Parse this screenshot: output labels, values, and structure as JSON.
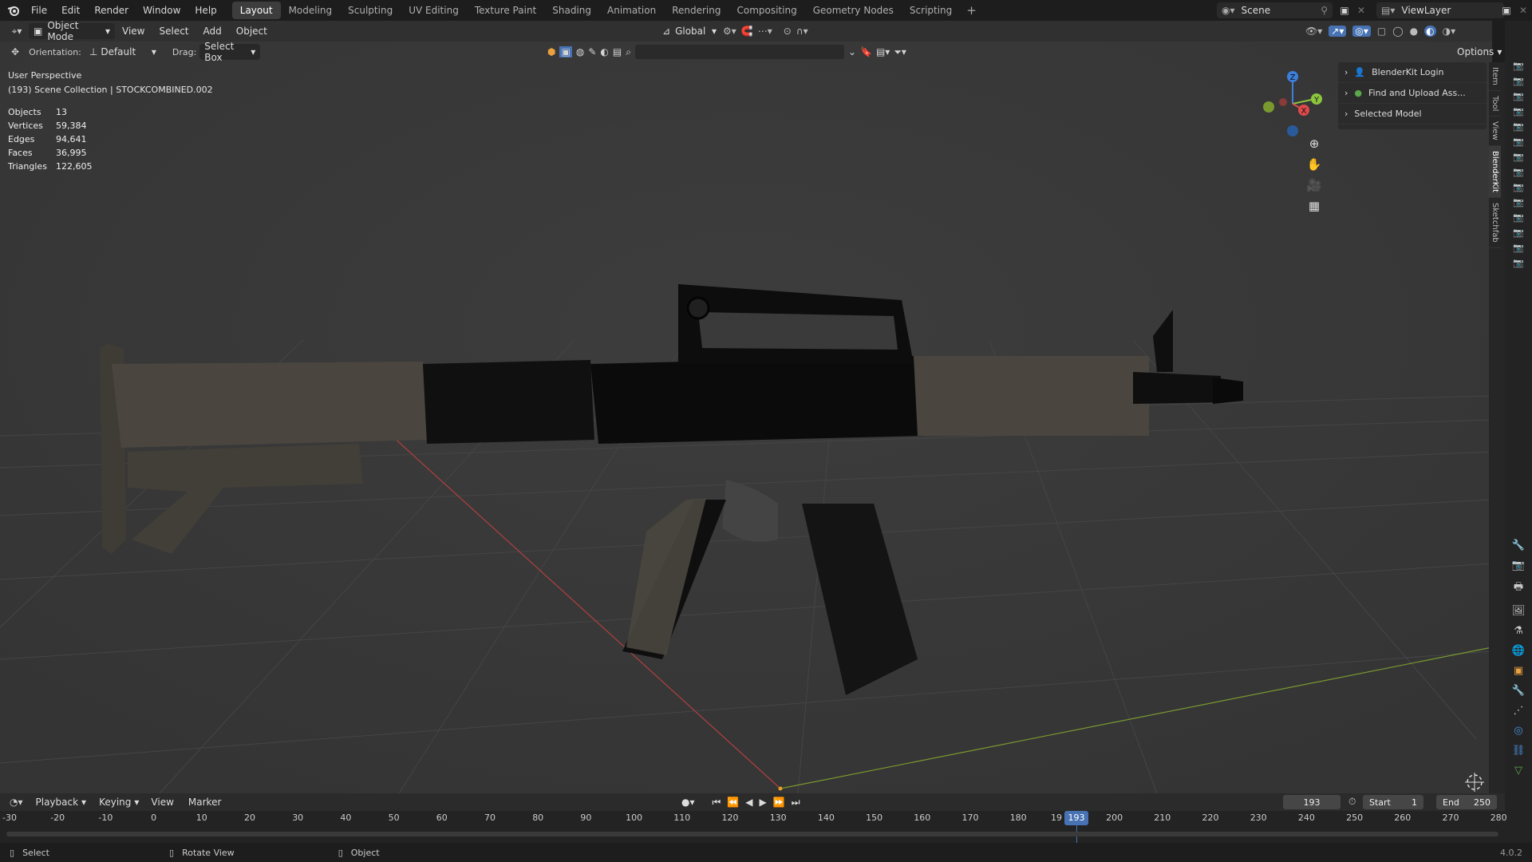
{
  "menu": {
    "file": "File",
    "edit": "Edit",
    "render": "Render",
    "window": "Window",
    "help": "Help"
  },
  "tabs": [
    "Layout",
    "Modeling",
    "Sculpting",
    "UV Editing",
    "Texture Paint",
    "Shading",
    "Animation",
    "Rendering",
    "Compositing",
    "Geometry Nodes",
    "Scripting"
  ],
  "tab_add": "+",
  "scene": {
    "label": "Scene",
    "view_layer": "ViewLayer"
  },
  "header": {
    "mode": "Object Mode",
    "view": "View",
    "select": "Select",
    "add": "Add",
    "object": "Object",
    "transform_orientation": "Global",
    "options": "Options"
  },
  "toolbar": {
    "orientation_label": "Orientation:",
    "orientation_value": "Default",
    "drag_label": "Drag:",
    "drag_value": "Select Box"
  },
  "overlay": {
    "perspective": "User Perspective",
    "collection": "(193) Scene Collection | STOCKCOMBINED.002"
  },
  "stats": [
    {
      "k": "Objects",
      "v": "13"
    },
    {
      "k": "Vertices",
      "v": "59,384"
    },
    {
      "k": "Edges",
      "v": "94,641"
    },
    {
      "k": "Faces",
      "v": "36,995"
    },
    {
      "k": "Triangles",
      "v": "122,605"
    }
  ],
  "npanel": [
    {
      "label": "BlenderKit Login"
    },
    {
      "label": "Find and Upload Ass..."
    },
    {
      "label": "Selected Model"
    }
  ],
  "vtabs": [
    "Item",
    "Tool",
    "View",
    "BlenderKit",
    "Sketchfab"
  ],
  "gizmo": {
    "x": "X",
    "y": "Y",
    "z": "Z"
  },
  "timeline": {
    "playback": "Playback",
    "keying": "Keying",
    "view": "View",
    "marker": "Marker",
    "current_frame": "193",
    "start_label": "Start",
    "start_value": "1",
    "end_label": "End",
    "end_value": "250",
    "ticks": [
      "-30",
      "-20",
      "-10",
      "0",
      "10",
      "20",
      "30",
      "40",
      "50",
      "60",
      "70",
      "80",
      "90",
      "100",
      "110",
      "120",
      "130",
      "140",
      "150",
      "160",
      "170",
      "180",
      "19",
      "193",
      "200",
      "210",
      "220",
      "230",
      "240",
      "250",
      "260",
      "270",
      "280"
    ]
  },
  "status": {
    "select": "Select",
    "rotate": "Rotate View",
    "object": "Object",
    "version": "4.0.2"
  },
  "colors": {
    "accent": "#4772b3",
    "axis_x": "#e04a4a",
    "axis_y": "#8cc63e",
    "axis_z": "#3d7fdc"
  }
}
